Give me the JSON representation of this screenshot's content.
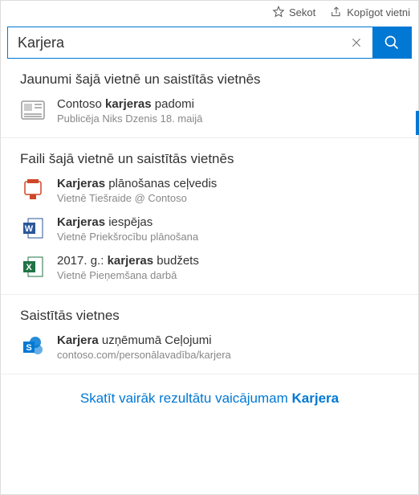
{
  "topbar": {
    "follow": "Sekot",
    "share": "Kopīgot vietni"
  },
  "search": {
    "value": "Karjera"
  },
  "sections": {
    "news": {
      "title": "Jaunumi šajā vietnē un saistītās vietnēs",
      "items": [
        {
          "title_pre": "Contoso ",
          "title_bold": "karjeras",
          "title_post": " padomi",
          "sub": "Publicēja Niks Dzenis 18. maijā"
        }
      ]
    },
    "files": {
      "title": "Faili šajā vietnē un saistītās vietnēs",
      "items": [
        {
          "title_bold": "Karjeras",
          "title_post": " plānošanas ceļvedis",
          "sub": "Vietnē Tiešraide @ Contoso"
        },
        {
          "title_bold": "Karjeras",
          "title_post": " iespējas",
          "sub": "Vietnē Priekšrocību plānošana"
        },
        {
          "title_pre": "2017. g.: ",
          "title_bold": "karjeras",
          "title_post": " budžets",
          "sub": "Vietnē Pieņemšana darbā"
        }
      ]
    },
    "sites": {
      "title": "Saistītās vietnes",
      "items": [
        {
          "title_bold": "Karjera",
          "title_post": " uzņēmumā Ceļojumi",
          "sub": "contoso.com/personālavadība/karjera"
        }
      ]
    }
  },
  "footer": {
    "text": "Skatīt vairāk rezultātu vaicājumam ",
    "bold": "Karjera"
  }
}
